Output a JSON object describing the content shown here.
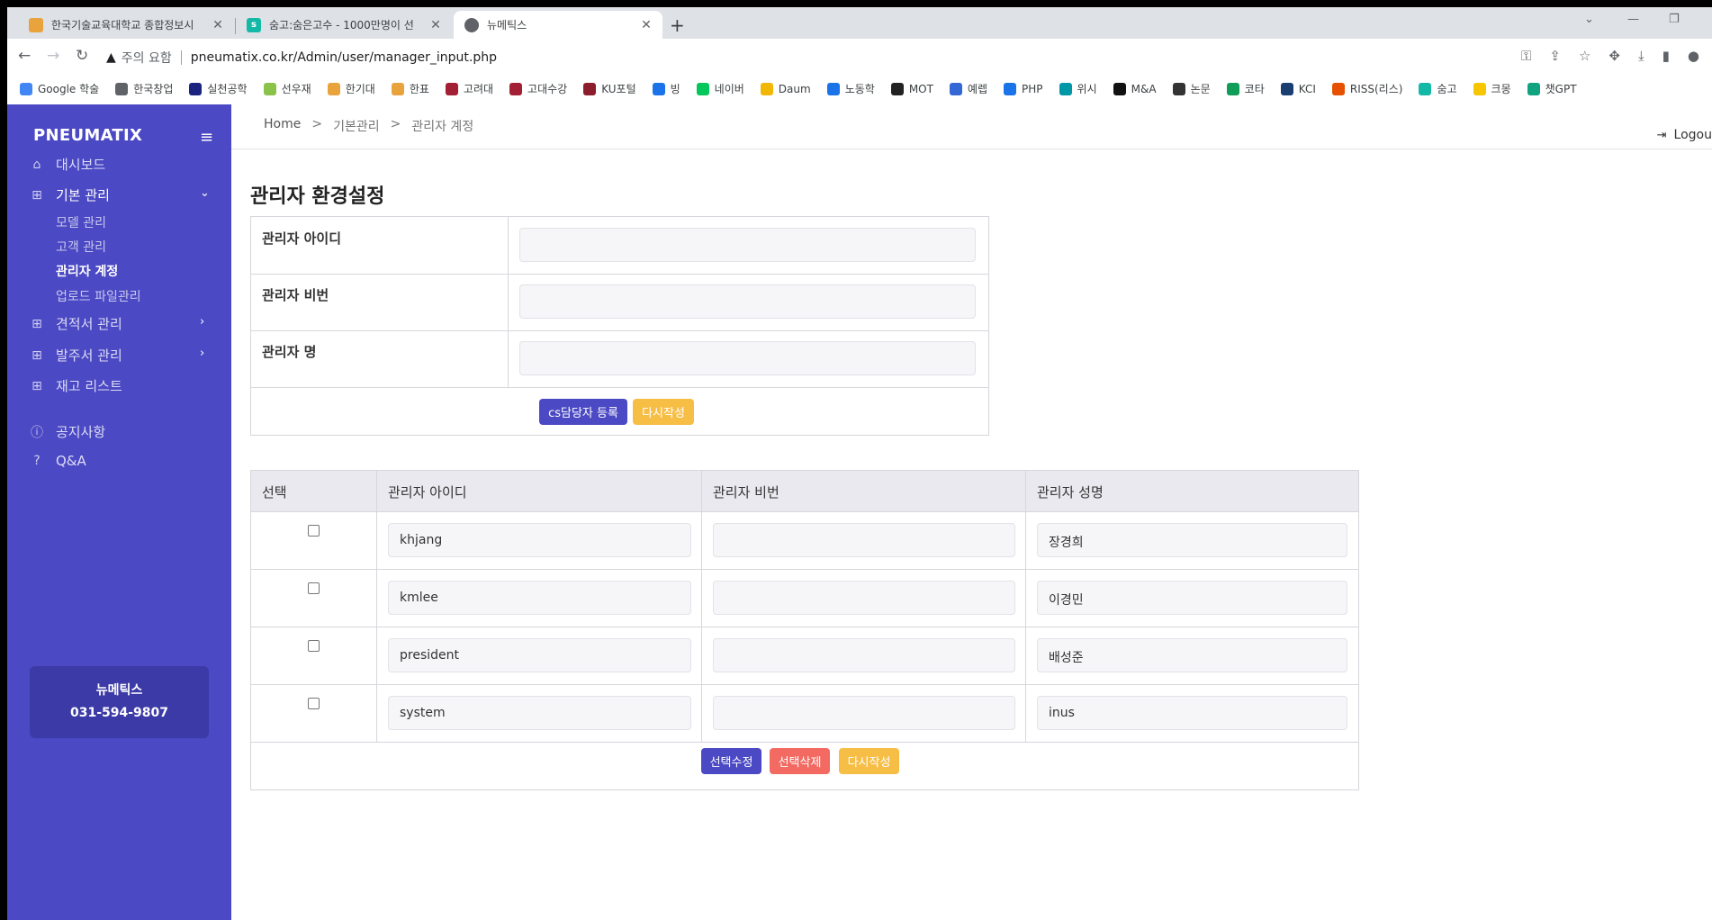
{
  "browser": {
    "tabs": [
      {
        "title": "한국기술교육대학교 종합정보시",
        "icon_color": "#e8a33d"
      },
      {
        "title": "숨고:숨은고수 - 1000만명이 선",
        "icon_color": "#14b8a6"
      },
      {
        "title": "뉴메틱스",
        "icon_color": "#5f6368"
      }
    ],
    "security_label": "주의 요함",
    "url": "pneumatix.co.kr/Admin/user/manager_input.php",
    "bookmarks": [
      {
        "label": "Google 학술",
        "color": "#4285f4"
      },
      {
        "label": "한국창업",
        "color": "#5f6368"
      },
      {
        "label": "실천공학",
        "color": "#1a237e"
      },
      {
        "label": "선우재",
        "color": "#8bc34a"
      },
      {
        "label": "한기대",
        "color": "#e8a33d"
      },
      {
        "label": "한표",
        "color": "#e8a33d"
      },
      {
        "label": "고려대",
        "color": "#a31f34"
      },
      {
        "label": "고대수강",
        "color": "#a31f34"
      },
      {
        "label": "KU포털",
        "color": "#8b1d2c"
      },
      {
        "label": "빙",
        "color": "#1a73e8"
      },
      {
        "label": "네이버",
        "color": "#03c75a"
      },
      {
        "label": "Daum",
        "color": "#f2b705"
      },
      {
        "label": "노동학",
        "color": "#1a73e8"
      },
      {
        "label": "MOT",
        "color": "#222222"
      },
      {
        "label": "예렙",
        "color": "#3367d6"
      },
      {
        "label": "PHP",
        "color": "#1a73e8"
      },
      {
        "label": "위시",
        "color": "#0097a7"
      },
      {
        "label": "M&A",
        "color": "#111111"
      },
      {
        "label": "논문",
        "color": "#333333"
      },
      {
        "label": "코타",
        "color": "#0f9d58"
      },
      {
        "label": "KCI",
        "color": "#1a3e72"
      },
      {
        "label": "RISS(리스)",
        "color": "#e65100"
      },
      {
        "label": "숨고",
        "color": "#14b8a6"
      },
      {
        "label": "크몽",
        "color": "#f7c600"
      },
      {
        "label": "챗GPT",
        "color": "#10a37f"
      }
    ]
  },
  "sidebar": {
    "brand": "PNEUMATIX",
    "items": [
      {
        "label": "대시보드"
      },
      {
        "label": "기본 관리"
      },
      {
        "label": "견적서 관리"
      },
      {
        "label": "발주서 관리"
      },
      {
        "label": "재고 리스트"
      },
      {
        "label": "공지사항"
      },
      {
        "label": "Q&A"
      }
    ],
    "sub_items": [
      {
        "label": "모델 관리"
      },
      {
        "label": "고객 관리"
      },
      {
        "label": "관리자 계정"
      },
      {
        "label": "업로드 파일관리"
      }
    ],
    "contact": {
      "name": "뉴메틱스",
      "phone": "031-594-9807"
    }
  },
  "topbar": {
    "breadcrumb": [
      "Home",
      ">",
      "기본관리",
      ">",
      "관리자 계정"
    ],
    "logout": "Logou"
  },
  "main": {
    "title": "관리자 환경설정",
    "form": {
      "fields": [
        {
          "label": "관리자 아이디",
          "value": ""
        },
        {
          "label": "관리자 비번",
          "value": ""
        },
        {
          "label": "관리자 명",
          "value": ""
        }
      ],
      "register_label": "cs담당자 등록",
      "reset_label": "다시작성"
    },
    "list": {
      "headers": [
        "선택",
        "관리자 아이디",
        "관리자 비번",
        "관리자 성명"
      ],
      "rows": [
        {
          "id": "khjang",
          "pw": "",
          "name": "장경희"
        },
        {
          "id": "kmlee",
          "pw": "",
          "name": "이경민"
        },
        {
          "id": "president",
          "pw": "",
          "name": "배성준"
        },
        {
          "id": "system",
          "pw": "",
          "name": "inus"
        }
      ],
      "edit_label": "선택수정",
      "delete_label": "선택삭제",
      "reset_label": "다시작성"
    }
  }
}
